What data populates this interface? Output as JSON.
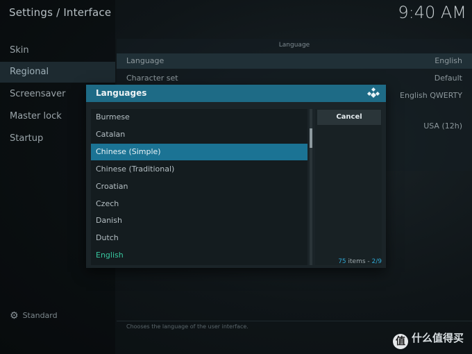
{
  "header": {
    "title": "Settings / Interface",
    "clock": "9:40 AM"
  },
  "sidebar": {
    "items": [
      {
        "label": "Skin"
      },
      {
        "label": "Regional"
      },
      {
        "label": "Screensaver"
      },
      {
        "label": "Master lock"
      },
      {
        "label": "Startup"
      }
    ],
    "level_label": "Standard"
  },
  "settings": {
    "section": "Language",
    "rows": [
      {
        "label": "Language",
        "value": "English"
      },
      {
        "label": "Character set",
        "value": "Default"
      },
      {
        "label": "",
        "value": "English QWERTY"
      },
      {
        "label": "",
        "value": "USA (12h)"
      }
    ],
    "hint": "Chooses the language of the user interface."
  },
  "dialog": {
    "title": "Languages",
    "items": [
      "Burmese",
      "Catalan",
      "Chinese (Simple)",
      "Chinese (Traditional)",
      "Croatian",
      "Czech",
      "Danish",
      "Dutch",
      "English"
    ],
    "selected_index": 2,
    "current_index": 8,
    "cancel_label": "Cancel",
    "count": "75",
    "count_suffix": " items - ",
    "page": "2/9"
  },
  "watermark": {
    "text": "什么值得买",
    "logo": "值"
  },
  "colors": {
    "accent": "#1b7394",
    "header": "#1e6b86",
    "current": "#38c8a0"
  }
}
